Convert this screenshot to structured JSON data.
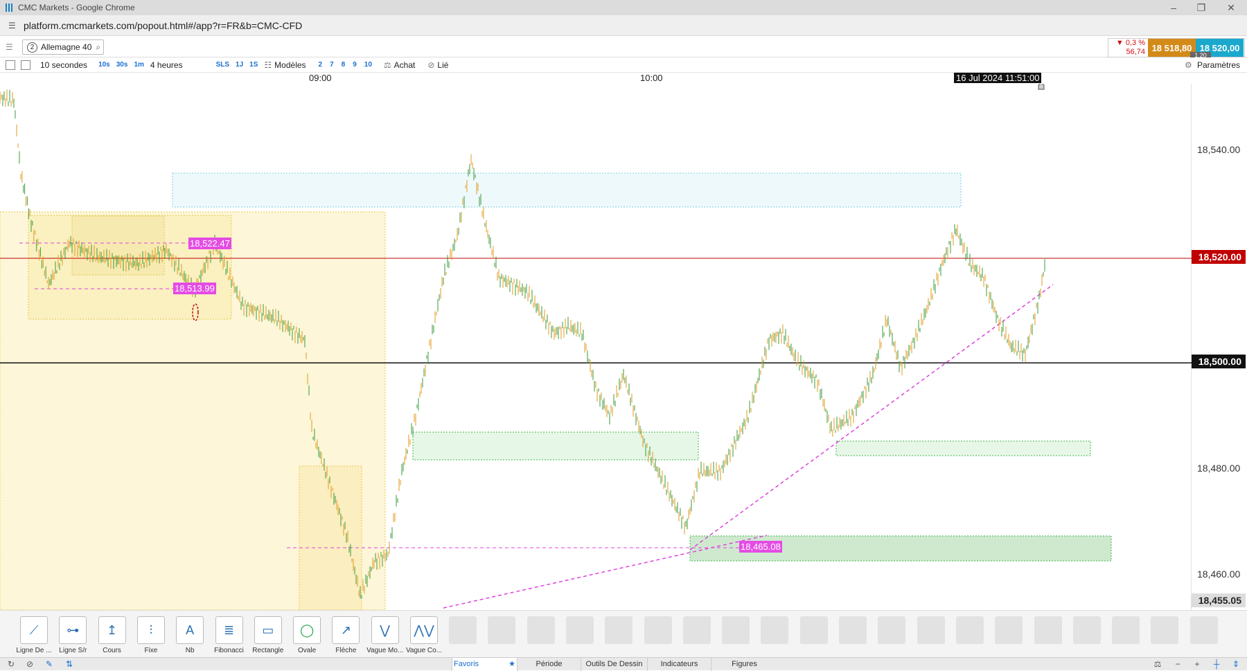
{
  "window": {
    "title": "CMC Markets - Google Chrome"
  },
  "browser": {
    "url": "platform.cmcmarkets.com/popout.html#/app?r=FR&b=CMC-CFD"
  },
  "instrument": {
    "number": "2",
    "name": "Allemagne 40"
  },
  "quote": {
    "change_pct": "▼ 0,3 %",
    "change_abs": "56,74",
    "sell": "18 518,80",
    "buy": "18 520,00",
    "spread": "1.20"
  },
  "toolbar": {
    "interval": "10 secondes",
    "interval_buttons": [
      "10s",
      "30s",
      "1m"
    ],
    "period": "4 heures",
    "period_buttons": [
      "SLS",
      "1J",
      "1S"
    ],
    "models": "Modèles",
    "model_buttons": [
      "2",
      "7",
      "8",
      "9",
      "10"
    ],
    "buy": "Achat",
    "linked": "Lié",
    "settings": "Paramètres"
  },
  "time_axis": {
    "labels": [
      "09:00",
      "10:00"
    ],
    "cursor_time": "16 Jul 2024 11:51:00"
  },
  "price_axis": {
    "ticks": [
      "18,540.00",
      "18,480.00",
      "18,460.00"
    ],
    "current_price": "18,520.00",
    "level_price": "18,500.00",
    "bottom_price": "18,455.05"
  },
  "chart_annotations": {
    "high_label": "18,522.47",
    "low_label": "18,513.99",
    "support_label": "18,465.08"
  },
  "colors": {
    "up": "#3a9a3a",
    "down": "#e09a1e",
    "current_line": "#c00000",
    "magenta": "#e040e0",
    "sell": "#d38a19",
    "buy": "#1aa8cd"
  },
  "drawing_tools": [
    {
      "label": "Ligne De ...",
      "icon": "line-icon"
    },
    {
      "label": "Ligne S/r",
      "icon": "sr-line-icon"
    },
    {
      "label": "Cours",
      "icon": "price-icon"
    },
    {
      "label": "Fixe",
      "icon": "fixed-icon"
    },
    {
      "label": "Nb",
      "icon": "text-icon"
    },
    {
      "label": "Fibonacci",
      "icon": "fibonacci-icon"
    },
    {
      "label": "Rectangle",
      "icon": "rectangle-icon"
    },
    {
      "label": "Ovale",
      "icon": "oval-icon"
    },
    {
      "label": "Flèche",
      "icon": "arrow-icon"
    },
    {
      "label": "Vague Mo...",
      "icon": "wave-icon"
    },
    {
      "label": "Vague Co...",
      "icon": "corrective-wave-icon"
    }
  ],
  "bottom_tabs": [
    "Favoris",
    "Période",
    "Outils De Dessin",
    "Indicateurs",
    "Figures"
  ]
}
